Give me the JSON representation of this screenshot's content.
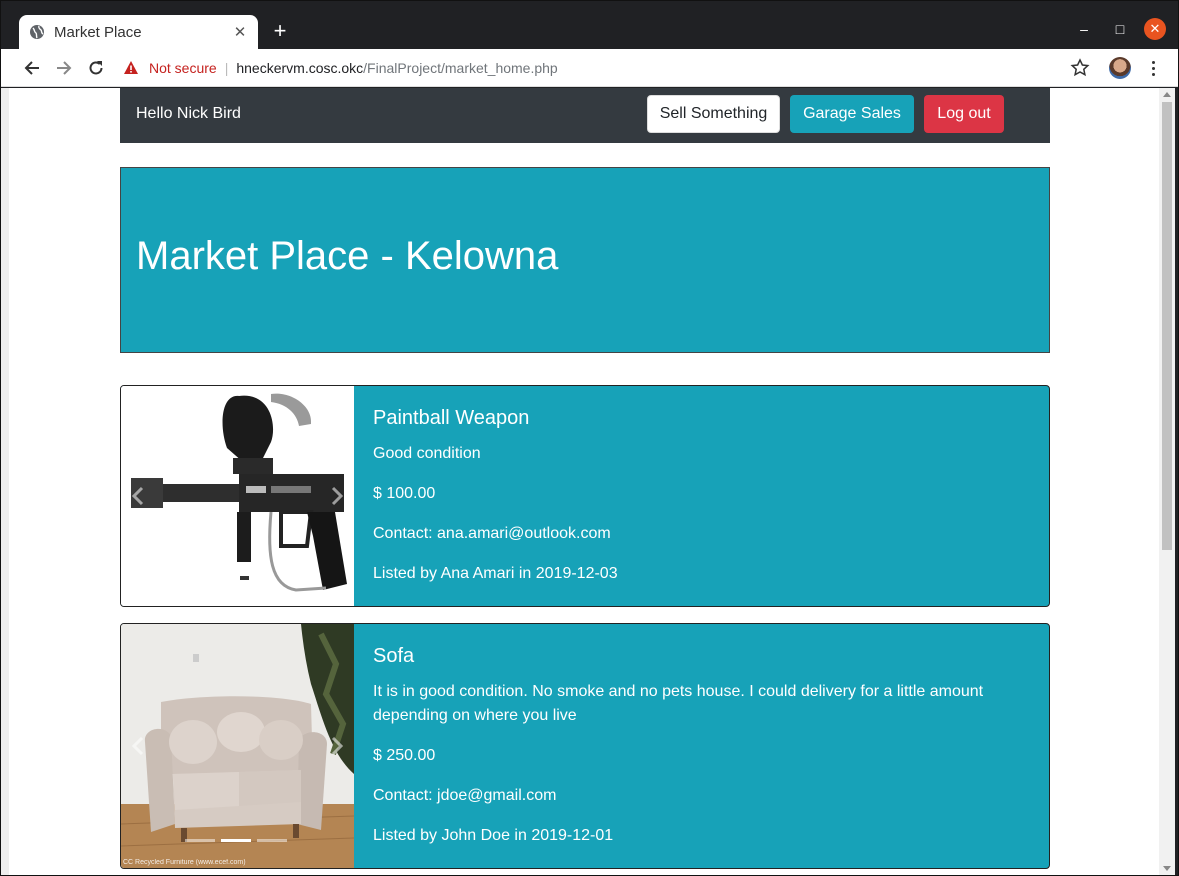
{
  "browser": {
    "tab_title": "Market Place",
    "security_label": "Not secure",
    "url_host": "hneckervm.cosc.okc",
    "url_path": "/FinalProject/market_home.php"
  },
  "navbar": {
    "greeting": "Hello Nick Bird",
    "sell_label": "Sell Something",
    "garage_label": "Garage Sales",
    "logout_label": "Log out"
  },
  "jumbotron": {
    "title": "Market Place - Kelowna"
  },
  "listings": [
    {
      "title": "Paintball Weapon",
      "description": "Good condition",
      "price": "$ 100.00",
      "contact": "Contact: ana.amari@outlook.com",
      "listed": "Listed by Ana Amari in 2019-12-03",
      "image": "paintball-marker"
    },
    {
      "title": "Sofa",
      "description": "It is in good condition. No smoke and no pets house. I could delivery for a little amount depending on where you live",
      "price": "$ 250.00",
      "contact": "Contact: jdoe@gmail.com",
      "listed": "Listed by John Doe in 2019-12-01",
      "image": "beige-loveseat",
      "image_credit": "CC Recycled Furniture (www.ecef.com)"
    }
  ],
  "colors": {
    "info": "#17a2b8",
    "dark": "#343a40",
    "danger": "#dc3545"
  }
}
